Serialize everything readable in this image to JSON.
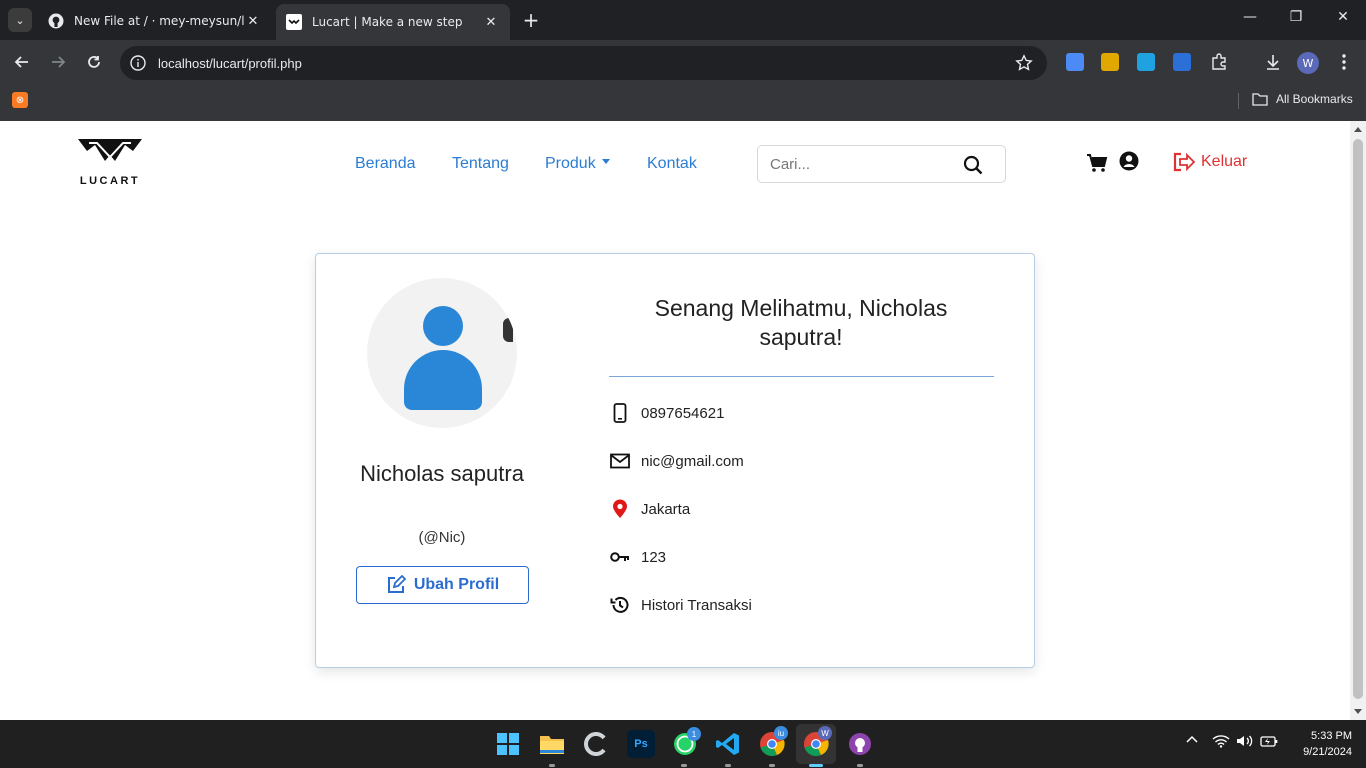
{
  "browser": {
    "tabs": [
      {
        "title": "New File at / · mey-meysun/lucart",
        "active": false
      },
      {
        "title": "Lucart | Make a new step",
        "active": true
      }
    ],
    "url": "localhost/lucart/profil.php",
    "bookmarks_label": "All Bookmarks",
    "profile_initial": "W"
  },
  "site": {
    "logo_text": "LUCART",
    "nav": [
      {
        "label": "Beranda"
      },
      {
        "label": "Tentang"
      },
      {
        "label": "Produk",
        "dropdown": true
      },
      {
        "label": "Kontak"
      }
    ],
    "search": {
      "placeholder": "Cari...",
      "value": ""
    },
    "logout_label": "Keluar",
    "accent_color": "#2b7cd3",
    "danger_color": "#e03131"
  },
  "profile": {
    "name": "Nicholas saputra",
    "handle": "(@Nic)",
    "edit_button": "Ubah Profil",
    "greeting": "Senang Melihatmu, Nicholas saputra!",
    "details": [
      {
        "icon": "phone-icon",
        "value": "0897654621"
      },
      {
        "icon": "envelope-icon",
        "value": "nic@gmail.com"
      },
      {
        "icon": "map-pin-icon",
        "value": "Jakarta"
      },
      {
        "icon": "key-icon",
        "value": "123"
      },
      {
        "icon": "history-icon",
        "value": "Histori Transaksi"
      }
    ]
  },
  "taskbar": {
    "time": "5:33 PM",
    "date": "9/21/2024",
    "whatsapp_badge": "1",
    "chrome_badge": "iu",
    "chrome_profile_badge": "W",
    "photoshop_label": "Ps"
  }
}
